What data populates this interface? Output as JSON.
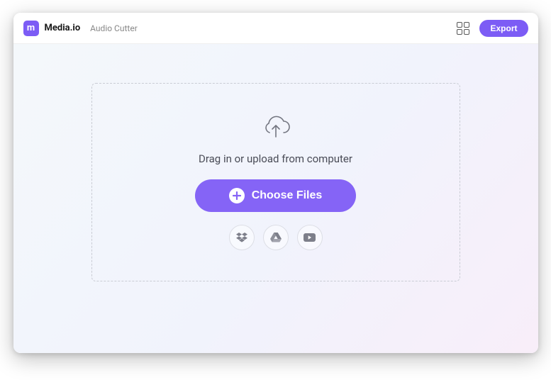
{
  "header": {
    "logo_glyph": "m",
    "brand": "Media.io",
    "tool_name": "Audio Cutter",
    "export_label": "Export"
  },
  "dropzone": {
    "hint": "Drag in or upload from computer",
    "choose_label": "Choose Files"
  },
  "sources": {
    "dropbox": "Dropbox",
    "gdrive": "Google Drive",
    "youtube": "YouTube"
  }
}
